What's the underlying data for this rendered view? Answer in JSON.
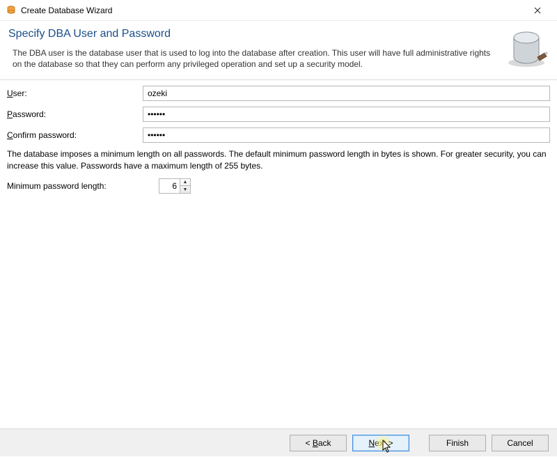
{
  "window": {
    "title": "Create Database Wizard"
  },
  "header": {
    "title": "Specify DBA User and Password",
    "description": "The DBA user is the database user that is used to log into the database after creation. This user will have full administrative rights on the database so that they can perform any privileged operation and set up a security model."
  },
  "form": {
    "user_label_pre": "U",
    "user_label_post": "ser:",
    "user_value": "ozeki",
    "password_label_pre": "P",
    "password_label_post": "assword:",
    "password_value": "••••••",
    "confirm_label_pre": "C",
    "confirm_label_post": "onfirm password:",
    "confirm_value": "••••••",
    "hint": "The database imposes a minimum length on all passwords. The default minimum password length in bytes is shown. For greater security, you can increase this value. Passwords have a maximum length of 255 bytes.",
    "minlen_label_pre": "M",
    "minlen_label_post": "inimum password length:",
    "minlen_value": "6"
  },
  "footer": {
    "back_pre": "< ",
    "back_u": "B",
    "back_post": "ack",
    "next_pre": "",
    "next_u": "N",
    "next_post": "ext >",
    "finish": "Finish",
    "cancel": "Cancel"
  }
}
